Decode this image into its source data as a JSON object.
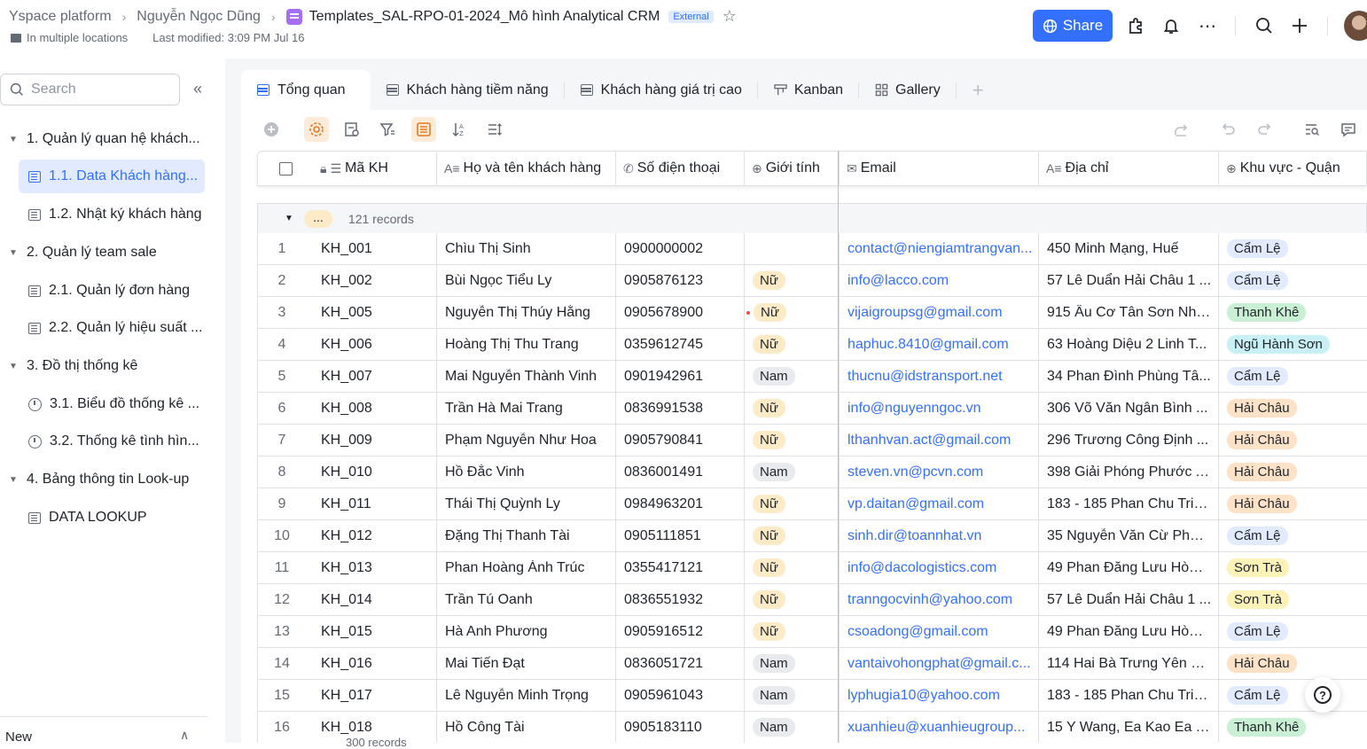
{
  "header": {
    "breadcrumbs": [
      "Yspace platform",
      "Nguyễn Ngọc Dũng"
    ],
    "doc_title": "Templates_SAL-RPO-01-2024_Mô hình Analytical CRM",
    "external_badge": "External",
    "location": "In multiple locations",
    "last_modified": "Last modified: 3:09 PM Jul 16",
    "share_label": "Share"
  },
  "sidebar": {
    "search_placeholder": "Search",
    "items": [
      {
        "label": "1. Quản lý quan hệ khách..."
      },
      {
        "label": "1.1. Data Khách hàng..."
      },
      {
        "label": "1.2. Nhật ký khách hàng"
      },
      {
        "label": "2. Quản lý team sale"
      },
      {
        "label": "2.1. Quản lý đơn hàng"
      },
      {
        "label": "2.2. Quản lý hiệu suất ..."
      },
      {
        "label": "3. Đồ thị thống kê"
      },
      {
        "label": "3.1. Biểu đồ thống kê ..."
      },
      {
        "label": "3.2. Thống kê tình hìn..."
      },
      {
        "label": "4. Bảng thông tin Look-up"
      },
      {
        "label": "DATA LOOKUP"
      }
    ],
    "bottom_label": "New"
  },
  "tabs": [
    "Tổng quan",
    "Khách hàng tiềm năng",
    "Khách hàng giá trị cao",
    "Kanban",
    "Gallery"
  ],
  "table": {
    "columns": [
      "Mã KH",
      "Họ và tên khách hàng",
      "Số điện thoại",
      "Giới tính",
      "Email",
      "Địa chỉ",
      "Khu vực - Quận"
    ],
    "group_dots": "...",
    "group_count": "121 records",
    "footer_count": "300 records",
    "rows": [
      [
        "1",
        "KH_001",
        "Chìu Thị Sinh",
        "0900000002",
        "",
        "contact@niengiamtrangvan...",
        "450 Minh Mạng, Huế",
        "Cẩm Lệ"
      ],
      [
        "2",
        "KH_002",
        "Bùi Ngọc Tiểu Ly",
        "0905876123",
        "Nữ",
        "info@lacco.com",
        "57 Lê Duẩn Hải Châu 1 ...",
        "Cẩm Lệ"
      ],
      [
        "3",
        "KH_005",
        "Nguyễn Thị Thúy Hằng",
        "0905678900",
        "Nữ",
        "vijaigroupsg@gmail.com",
        "915 Âu Cơ Tân Sơn Nhì ...",
        "Thanh Khê"
      ],
      [
        "4",
        "KH_006",
        "Hoàng Thị Thu Trang",
        "0359612745",
        "Nữ",
        "haphuc.8410@gmail.com",
        "63 Hoàng Diệu 2 Linh T...",
        "Ngũ Hành Sơn"
      ],
      [
        "5",
        "KH_007",
        "Mai Nguyễn Thành Vinh",
        "0901942961",
        "Nam",
        "thucnu@idstransport.net",
        "34 Phan Đình Phùng Tâ...",
        "Cẩm Lệ"
      ],
      [
        "6",
        "KH_008",
        "Trần Hà Mai Trang",
        "0836991538",
        "Nữ",
        "info@nguyenngoc.vn",
        "306 Võ Văn Ngân Bình ...",
        "Hải Châu"
      ],
      [
        "7",
        "KH_009",
        "Phạm Nguyễn Như Hoa",
        "0905790841",
        "Nữ",
        "lthanhvan.act@gmail.com",
        "296 Trương Công Định ...",
        "Hải Châu"
      ],
      [
        "8",
        "KH_010",
        "Hồ Đắc Vinh",
        "0836001491",
        "Nam",
        "steven.vn@pcvn.com",
        "398 Giải Phóng Phước A...",
        "Hải Châu"
      ],
      [
        "9",
        "KH_011",
        "Thái Thị Quỳnh Ly",
        "0984963201",
        "Nữ",
        "vp.daitan@gmail.com",
        "183 - 185 Phan Chu Trin...",
        "Hải Châu"
      ],
      [
        "10",
        "KH_012",
        "Đặng Thị Thanh Tài",
        "0905111851",
        "Nữ",
        "sinh.dir@toannhat.vn",
        "35 Nguyễn Văn Cừ Phư...",
        "Cẩm Lệ"
      ],
      [
        "11",
        "KH_013",
        "Phan Hoàng Ánh Trúc",
        "0355417121",
        "Nữ",
        "info@dacologistics.com",
        "49 Phan Đăng Lưu Hòa ...",
        "Sơn Trà"
      ],
      [
        "12",
        "KH_014",
        "Trần Tú Oanh",
        "0836551932",
        "Nữ",
        "tranngocvinh@yahoo.com",
        "57 Lê Duẩn Hải Châu 1 ...",
        "Sơn Trà"
      ],
      [
        "13",
        "KH_015",
        "Hà Anh Phương",
        "0905916512",
        "Nữ",
        "csoadong@gmail.com",
        "49 Phan Đăng Lưu Hòa ...",
        "Cẩm Lệ"
      ],
      [
        "14",
        "KH_016",
        "Mai Tiến Đạt",
        "0836051721",
        "Nam",
        "vantaivohongphat@gmail.c...",
        "114 Hai Bà Trưng Yên Đ...",
        "Hải Châu"
      ],
      [
        "15",
        "KH_017",
        "Lê Nguyễn Minh Trọng",
        "0905961043",
        "Nam",
        "lyphugia10@yahoo.com",
        "183 - 185 Phan Chu Trin...",
        "Cẩm Lệ"
      ],
      [
        "16",
        "KH_018",
        "Hồ Công Tài",
        "0905183110",
        "Nam",
        "xuanhieu@xuanhieugroup...",
        "15 Y Wang, Ea Kao Ea T...",
        "Thanh Khê"
      ]
    ]
  },
  "tag_colors": {
    "Nữ": "#fdebc8",
    "Nam": "#e8eaed",
    "Cẩm Lệ": "#e1eaff",
    "Thanh Khê": "#c9f0d4",
    "Ngũ Hành Sơn": "#c8f0f5",
    "Hải Châu": "#fde2c8",
    "Sơn Trà": "#fdf2b8"
  },
  "colors": {
    "accent": "#3370ff"
  }
}
